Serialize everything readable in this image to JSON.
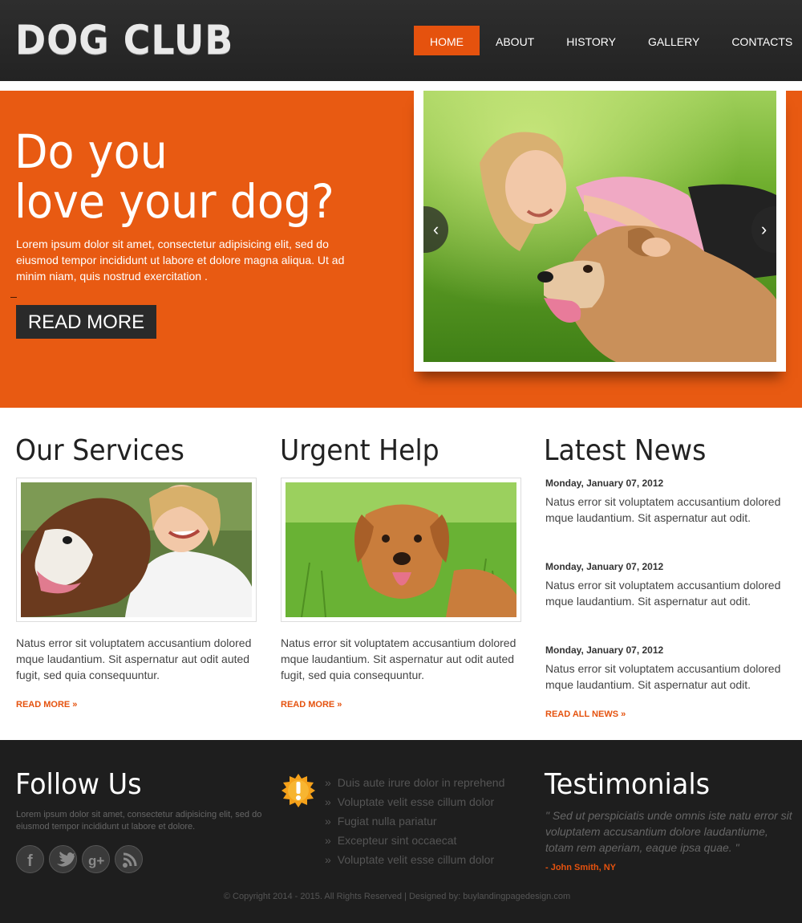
{
  "header": {
    "logo": "DOG CLUB",
    "nav": [
      {
        "label": "HOME"
      },
      {
        "label": "ABOUT"
      },
      {
        "label": "HISTORY"
      },
      {
        "label": "GALLERY"
      },
      {
        "label": "CONTACTS"
      }
    ],
    "active_nav": "HOME"
  },
  "hero": {
    "title_line1": "Do you",
    "title_line2": "love your dog?",
    "text": "Lorem ipsum dolor sit amet, consectetur adipisicing elit, sed do eiusmod tempor incididunt ut labore et dolore magna aliqua. Ut ad minim niam, quis nostrud exercitation .",
    "button": "READ MORE",
    "slider_prev": "‹",
    "slider_next": "›"
  },
  "services": {
    "title": "Our Services",
    "text": "Natus error sit voluptatem accusantium dolored mque laudantium. Sit aspernatur aut odit auted fugit, sed quia consequuntur.",
    "link": "READ MORE »"
  },
  "urgent": {
    "title": "Urgent Help",
    "text": "Natus error sit voluptatem accusantium dolored mque laudantium. Sit aspernatur aut odit auted fugit, sed quia consequuntur.",
    "link": "READ MORE »"
  },
  "news": {
    "title": "Latest News",
    "items": [
      {
        "date": "Monday, January 07, 2012",
        "text": "Natus error sit voluptatem accusantium dolored mque laudantium. Sit aspernatur aut odit."
      },
      {
        "date": "Monday, January 07, 2012",
        "text": "Natus error sit voluptatem accusantium dolored mque laudantium. Sit aspernatur aut odit."
      },
      {
        "date": "Monday, January 07, 2012",
        "text": "Natus error sit voluptatem accusantium dolored mque laudantium. Sit aspernatur aut odit."
      }
    ],
    "link": "READ ALL NEWS »"
  },
  "footer": {
    "follow_title": "Follow Us",
    "follow_text": "Lorem ipsum dolor sit amet, consectetur adipisicing elit, sed do eiusmod tempor incididunt ut labore et dolore.",
    "social": [
      "facebook-icon",
      "twitter-icon",
      "google-plus-icon",
      "rss-icon"
    ],
    "list_bullet": "»",
    "list": [
      "Duis aute irure dolor in reprehend",
      "Voluptate velit esse cillum dolor",
      "Fugiat nulla pariatur",
      "Excepteur sint occaecat",
      "Voluptate velit esse cillum dolor"
    ],
    "testimonials_title": "Testimonials",
    "quote": "\" Sed ut perspiciatis unde omnis iste natu error sit voluptatem accusantium dolore laudantiume, totam rem aperiam, eaque ipsa quae. \"",
    "quote_author": "- John Smith, NY",
    "copyright": "© Copyright 2014 - 2015. All Rights Reserved | Designed by: buylandingpagedesign.com"
  },
  "colors": {
    "accent": "#e5520e",
    "hero_bg": "#e85a12",
    "header_bg": "#2a2a2a",
    "footer_bg": "#1e1e1e"
  }
}
